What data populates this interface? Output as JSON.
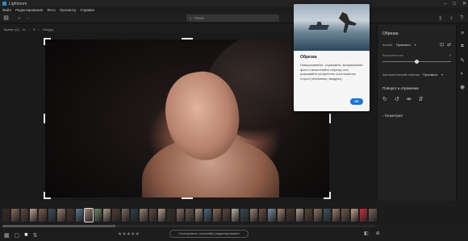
{
  "window": {
    "title": "Lightroom"
  },
  "menu": [
    "Файл",
    "Редактирование",
    "Фото",
    "Просмотр",
    "Справка"
  ],
  "search": {
    "placeholder": "Поиск"
  },
  "breadcrumb": {
    "album": "Кратко (1)",
    "separator": "•••",
    "counter": "1",
    "filename": "cha.jpg"
  },
  "popover": {
    "title": "Обрезка",
    "text": "Поворачивайте, отражайте, выпрямляйте фото и выполняйте обрезку или указывайте конкретное соотношение сторон (например, квадрат).",
    "ok": "OK"
  },
  "right_panel": {
    "title": "Обрезка",
    "aspect_label": "Аспект",
    "aspect_value": "Произвол.",
    "straighten_label": "Выпрямление",
    "straighten_value": "0",
    "straighten_fraction": 0.5,
    "auto_label": "Автоматический обрезки",
    "auto_value": "Произвол.",
    "rotate_section": "Поворот и отражение",
    "geometry": "Геометрия"
  },
  "filmstrip": {
    "thumb_colors": [
      "#3b2a25",
      "#8a6b5a",
      "#5d4a3f",
      "#c2a590",
      "#7a5f50",
      "#3c4f5d",
      "#9b8070",
      "#4a3a33",
      "#5b7a8c",
      "#a48a77",
      "#6e8a6a",
      "#b39b8a",
      "#4f3d35",
      "#7f6a60",
      "#2c3c48",
      "#9a7f6e",
      "#5a4a40",
      "#b8a090",
      "#3a2f2b",
      "#8e7566",
      "#6a5850",
      "#a78f80",
      "#4d6a80",
      "#8b6a58",
      "#5f4a3e",
      "#c2b0a3",
      "#394a58",
      "#9c8476",
      "#6b5043",
      "#7a8fa0",
      "#a38572",
      "#4a3a32",
      "#b39c8c",
      "#5b4638",
      "#8a7060",
      "#3d5566",
      "#a07a6a",
      "#6f5a4e",
      "#c7a090",
      "#d03040",
      "#7a6355"
    ],
    "selected_index": 9,
    "scroll_fraction": 0.3
  },
  "bottombar": {
    "stars": "★★★★★",
    "copy_label": "Скопировать настройки редактирования"
  },
  "icons": {
    "toolbar_left": [
      "sidebar-icon",
      "arrow-left-icon",
      "arrow-right-icon"
    ],
    "toolbar_right": [
      "upload-icon",
      "bell-icon",
      "help-icon"
    ],
    "rail": [
      "sliders-icon",
      "crop-icon",
      "healing-icon",
      "masking-icon",
      "redeye-icon",
      "presets-icon",
      "info-icon"
    ]
  }
}
